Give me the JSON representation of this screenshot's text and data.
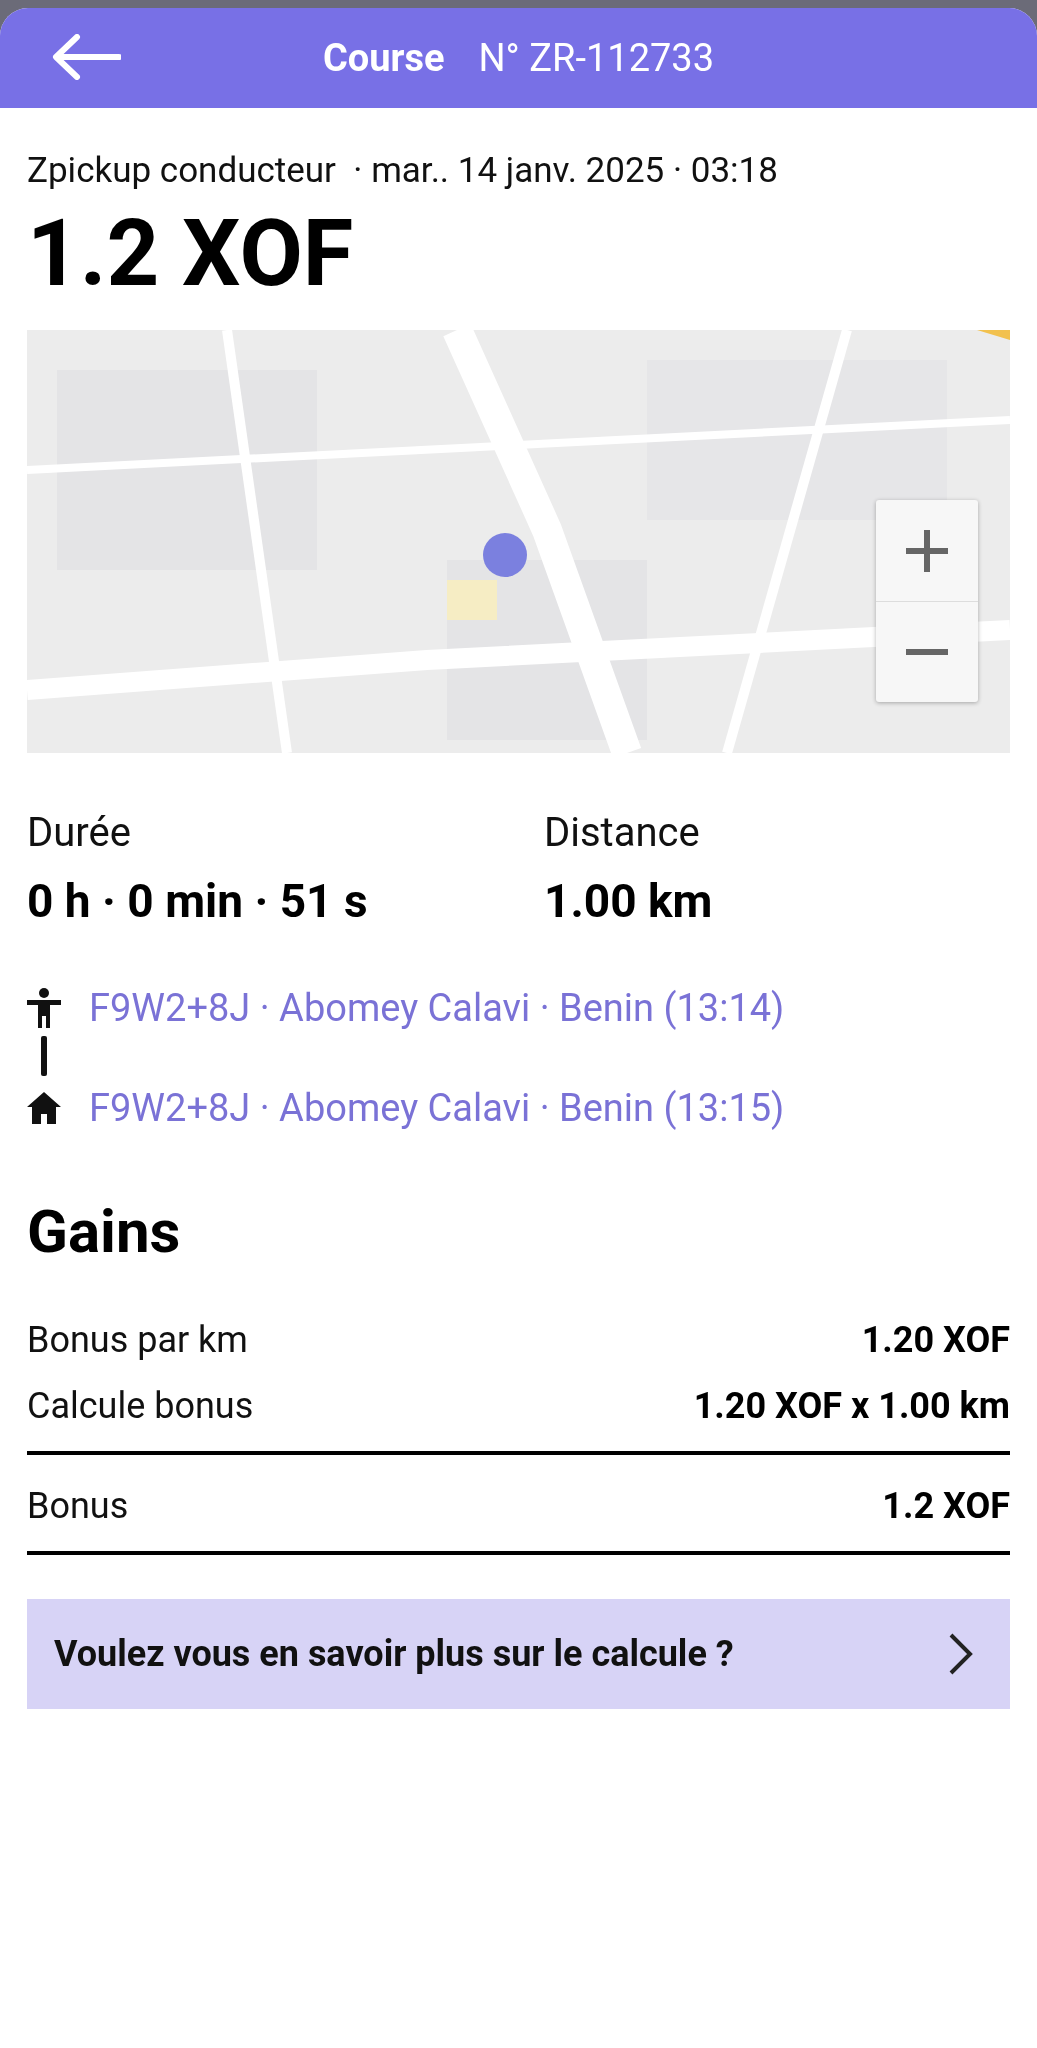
{
  "header": {
    "title": "Course",
    "number": "N° ZR-112733"
  },
  "meta": "Zpickup conducteur  · mar.. 14 janv. 2025 · 03:18",
  "price": "1.2 XOF",
  "stats": [
    {
      "label": "Durée",
      "value": "0 h · 0 min · 51 s"
    },
    {
      "label": "Distance",
      "value": "1.00 km"
    }
  ],
  "route": [
    {
      "kind": "pickup",
      "address": "F9W2+8J · Abomey Calavi · Benin (13:14)"
    },
    {
      "kind": "dropoff",
      "address": "F9W2+8J · Abomey Calavi · Benin (13:15)"
    }
  ],
  "gains": {
    "title": "Gains",
    "rows": [
      {
        "label": "Bonus par km",
        "value": "1.20 XOF",
        "divider_after": false
      },
      {
        "label": "Calcule bonus",
        "value": "1.20 XOF x 1.00 km",
        "divider_after": true
      },
      {
        "label": "Bonus",
        "value": "1.2 XOF",
        "divider_after": true
      }
    ]
  },
  "info_button": "Voulez vous en savoir plus sur le calcule ?"
}
